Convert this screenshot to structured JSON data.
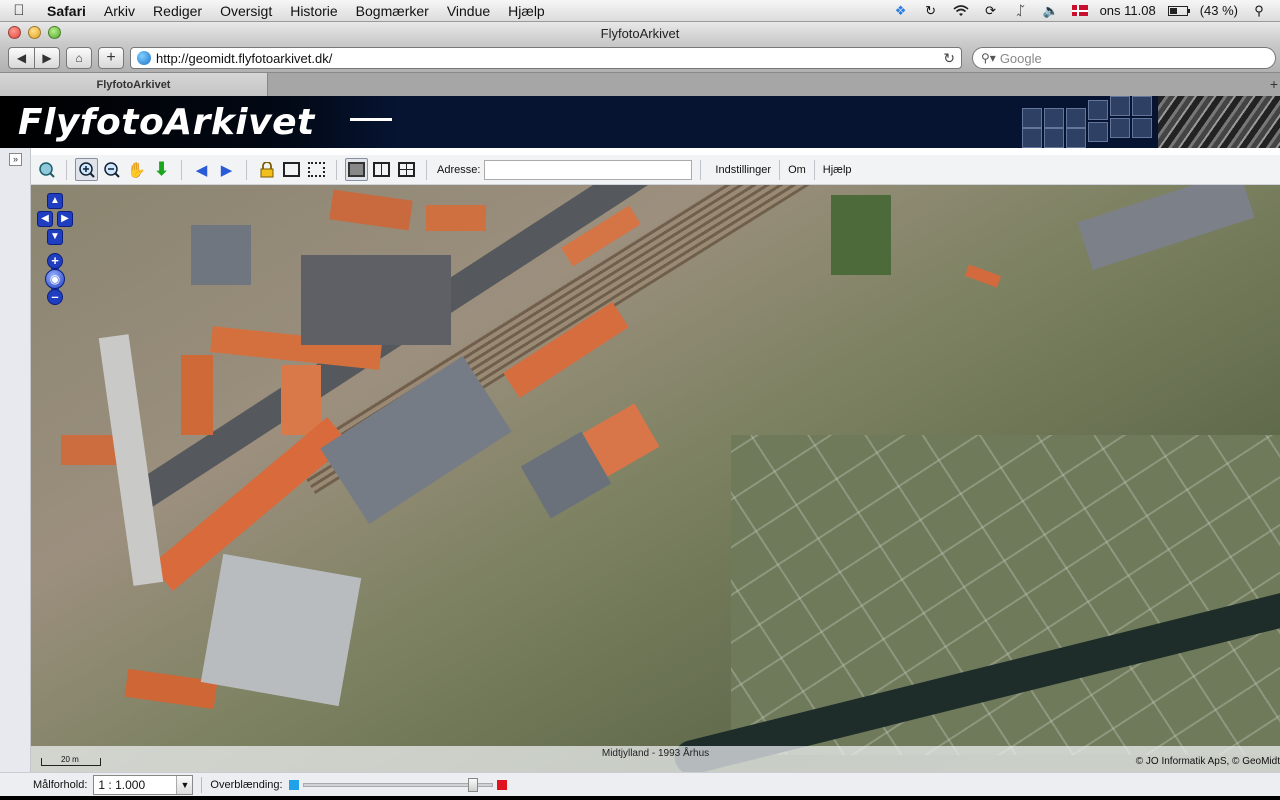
{
  "menubar": {
    "apple_icon": "apple-logo",
    "app_name": "Safari",
    "items": [
      "Arkiv",
      "Rediger",
      "Oversigt",
      "Historie",
      "Bogmærker",
      "Vindue",
      "Hjælp"
    ],
    "clock": "ons 11.08",
    "battery": "(43 %)",
    "battery_level_percent": 43
  },
  "window": {
    "title": "FlyfotoArkivet"
  },
  "browser": {
    "url": "http://geomidt.flyfotoarkivet.dk/",
    "search_placeholder": "Google",
    "tab_title": "FlyfotoArkivet"
  },
  "banner": {
    "logo_text": "FlyfotoArkivet"
  },
  "map_toolbar": {
    "address_label": "Adresse:",
    "address_value": "",
    "links": {
      "settings": "Indstillinger",
      "about": "Om",
      "help": "Hjælp"
    }
  },
  "map": {
    "caption": "Midtjylland - 1993 Århus",
    "copyright": "© JO Informatik ApS, © GeoMidt",
    "scale_label": "20 m"
  },
  "bottombar": {
    "scale_label": "Målforhold:",
    "scale_value": "1 : 1.000",
    "blend_label": "Overblænding:",
    "blend_level": 0.92
  },
  "colors": {
    "banner_bg": "#061432",
    "nav_blue": "#1f3ec0",
    "slider_left": "#1fa2e8",
    "slider_right": "#e0141e"
  }
}
